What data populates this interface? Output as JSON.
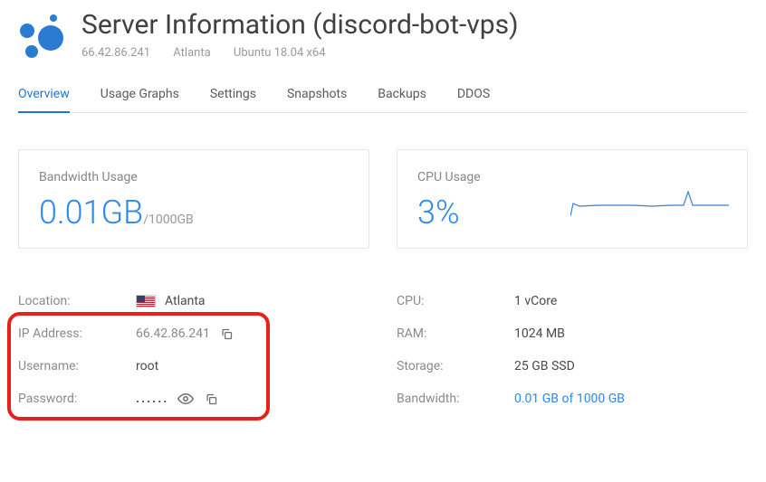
{
  "header": {
    "title": "Server Information (discord-bot-vps)",
    "ip": "66.42.86.241",
    "region": "Atlanta",
    "os": "Ubuntu 18.04 x64"
  },
  "tabs": [
    "Overview",
    "Usage Graphs",
    "Settings",
    "Snapshots",
    "Backups",
    "DDOS"
  ],
  "cards": {
    "bandwidth": {
      "title": "Bandwidth Usage",
      "used": "0.01GB",
      "total": "/1000GB"
    },
    "cpu": {
      "title": "CPU Usage",
      "value": "3%"
    }
  },
  "left": {
    "location": {
      "label": "Location:",
      "value": "Atlanta"
    },
    "ip": {
      "label": "IP Address:",
      "value": "66.42.86.241"
    },
    "username": {
      "label": "Username:",
      "value": "root"
    },
    "password": {
      "label": "Password:",
      "value": "......"
    }
  },
  "right": {
    "cpu": {
      "label": "CPU:",
      "value": "1 vCore"
    },
    "ram": {
      "label": "RAM:",
      "value": "1024 MB"
    },
    "storage": {
      "label": "Storage:",
      "value": "25 GB SSD"
    },
    "bandwidth": {
      "label": "Bandwidth:",
      "value": "0.01 GB of 1000 GB"
    }
  }
}
